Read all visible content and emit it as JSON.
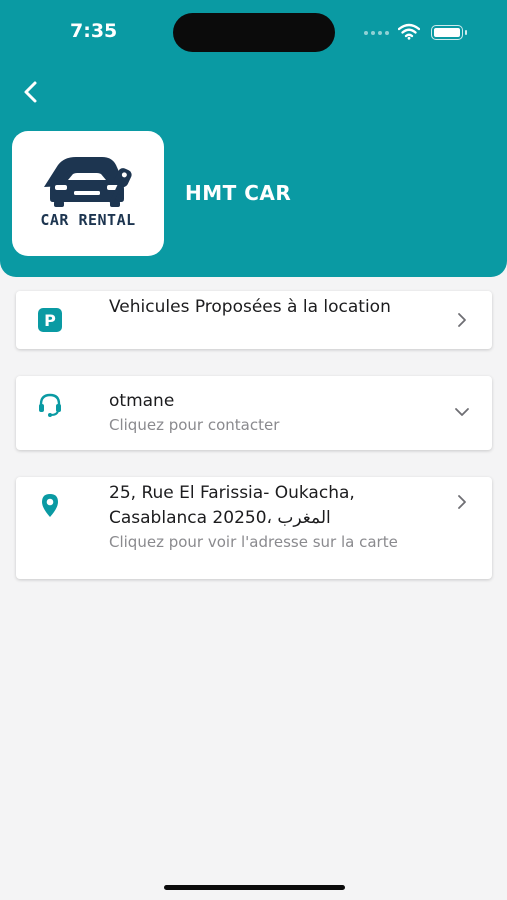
{
  "status_bar": {
    "time": "7:35"
  },
  "header": {
    "back_icon": "chevron-left-icon",
    "logo_text": "CAR RENTAL",
    "company_name": "HMT CAR",
    "background_color": "#0a9aa3"
  },
  "items": [
    {
      "icon": "parking-icon",
      "title": "Vehicules Proposées à la location",
      "trailing_icon": "chevron-right-icon"
    },
    {
      "icon": "headset-icon",
      "title": "otmane",
      "subtitle": "Cliquez pour contacter",
      "trailing_icon": "chevron-down-icon"
    },
    {
      "icon": "location-pin-icon",
      "title": "25, Rue El Farissia- Oukacha, Casablanca 20250، المغرب",
      "subtitle": "Cliquez pour voir l'adresse sur la carte",
      "trailing_icon": "chevron-right-icon"
    }
  ],
  "colors": {
    "accent": "#0a9aa3",
    "background": "#f4f4f5",
    "logo": "#1d3550"
  }
}
